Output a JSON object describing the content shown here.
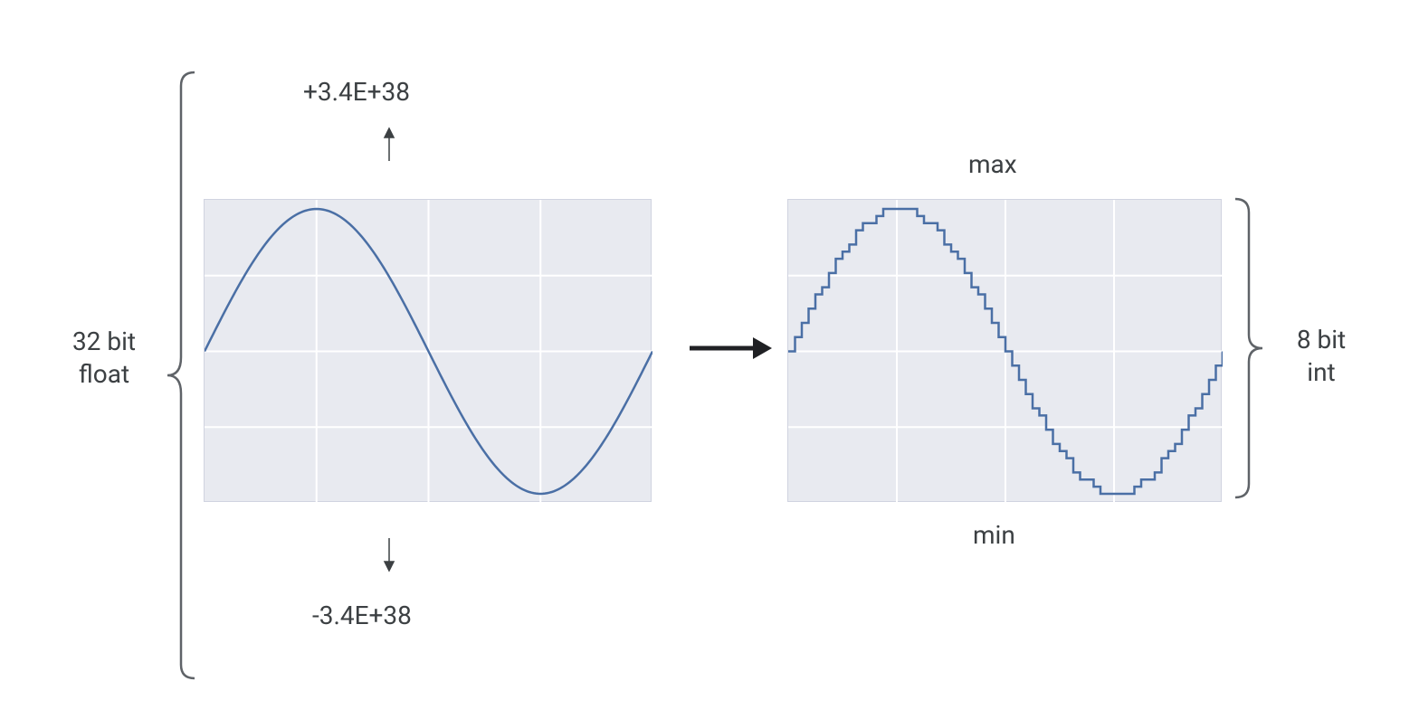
{
  "left": {
    "title_top": "32 bit",
    "title_bottom": "float",
    "max_value": "+3.4E+38",
    "min_value": "-3.4E+38"
  },
  "right": {
    "title_top": "8 bit",
    "title_bottom": "int",
    "max_label": "max",
    "min_label": "min"
  },
  "chart_data": [
    {
      "type": "line",
      "title": "32-bit float continuous sine wave",
      "x": [
        0,
        0.1,
        0.2,
        0.3,
        0.4,
        0.5,
        0.6,
        0.7,
        0.8,
        0.9,
        1.0
      ],
      "values": [
        0,
        0.588,
        0.951,
        0.951,
        0.588,
        0,
        -0.588,
        -0.951,
        -0.951,
        -0.588,
        0
      ],
      "xlim": [
        0,
        1
      ],
      "ylim": [
        -1,
        1
      ],
      "xlabel": "",
      "ylabel": ""
    },
    {
      "type": "line",
      "title": "8-bit int quantized sine wave (step function)",
      "x": [
        0,
        0.1,
        0.2,
        0.3,
        0.4,
        0.5,
        0.6,
        0.7,
        0.8,
        0.9,
        1.0
      ],
      "values": [
        0,
        0.6,
        0.95,
        0.95,
        0.6,
        0,
        -0.6,
        -0.95,
        -0.95,
        -0.6,
        0
      ],
      "xlim": [
        0,
        1
      ],
      "ylim": [
        -1,
        1
      ],
      "xlabel": "",
      "ylabel": "",
      "quantized": true
    }
  ]
}
